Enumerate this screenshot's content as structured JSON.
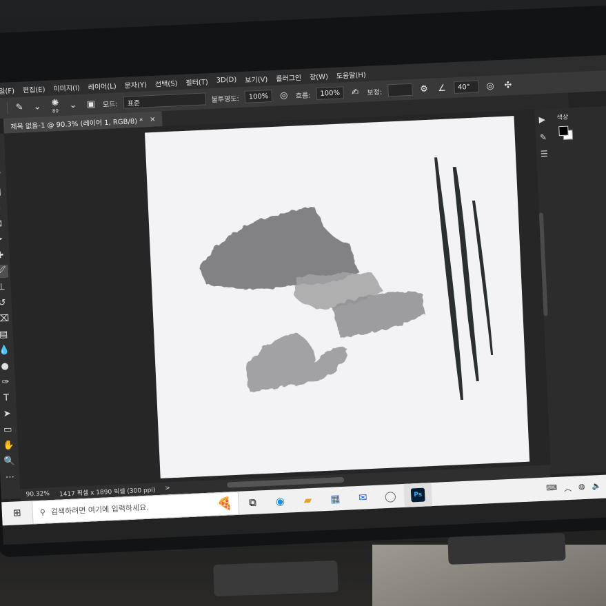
{
  "menu": [
    "파일(F)",
    "편집(E)",
    "이미지(I)",
    "레이어(L)",
    "문자(Y)",
    "선택(S)",
    "필터(T)",
    "3D(D)",
    "보기(V)",
    "플러그인",
    "창(W)",
    "도움말(H)"
  ],
  "options_bar": {
    "brush_size": "80",
    "mode_label": "모드:",
    "mode_value": "표준",
    "opacity_label": "불투명도:",
    "opacity_value": "100%",
    "flow_label": "흐름:",
    "flow_value": "100%",
    "smoothing_label": "보정:",
    "angle_value": "40°"
  },
  "document_tab": {
    "title": "제목 없음-1 @ 90.3% (레이어 1, RGB/8) *",
    "close": "×"
  },
  "status_bar": {
    "zoom": "90.32%",
    "doc_info": "1417 픽셀 x 1890 픽셀 (300 ppi)",
    "arrow": ">"
  },
  "right_panel": {
    "color_label": "색상"
  },
  "taskbar": {
    "search_placeholder": "검색하려면 여기에 입력하세요.",
    "ps_label": "Ps"
  },
  "icons": {
    "home": "home-icon",
    "brush": "brush-icon",
    "search": "search-icon",
    "windows": "windows-logo-icon"
  },
  "colors": {
    "foreground": "#000000",
    "background": "#ffffff",
    "accent_ps": "#31a8ff"
  }
}
